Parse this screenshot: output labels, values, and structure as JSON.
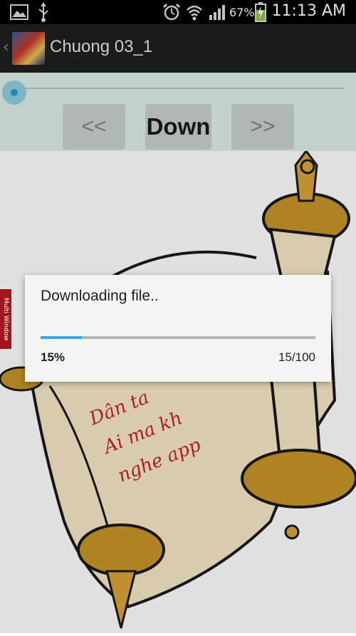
{
  "status_bar": {
    "battery_percent": "67%",
    "time": "11:13 AM",
    "icons": [
      "image-icon",
      "usb-icon",
      "alarm-icon",
      "wifi-icon",
      "signal-icon",
      "battery-charging-icon"
    ]
  },
  "action_bar": {
    "title": "Chuong 03_1",
    "back_icon": "chevron-left-icon"
  },
  "controls": {
    "prev_label": "<<",
    "down_label": "Down",
    "next_label": ">>",
    "seek_position": 0.0
  },
  "content_image": {
    "scroll_text_lines": [
      "Dân ta",
      "Ai ma kh",
      "nghe app"
    ]
  },
  "side_tab": {
    "label": "Multi Window"
  },
  "dialog": {
    "title": "Downloading file..",
    "progress_percent_label": "15%",
    "progress_count_label": "15/100",
    "progress_value": 0.15,
    "accent_color": "#38a9de"
  }
}
